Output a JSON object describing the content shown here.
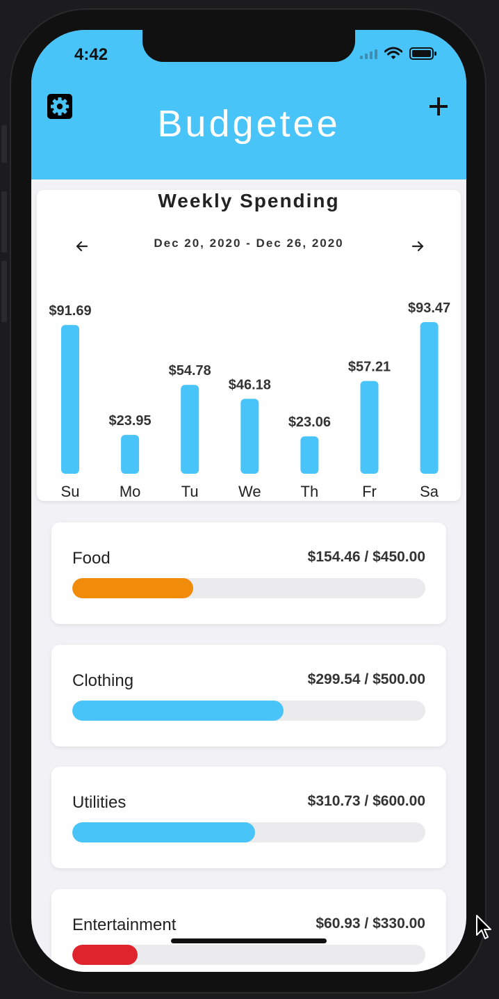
{
  "status_bar": {
    "time": "4:42"
  },
  "header": {
    "title": "Budgetee",
    "background_color": "#48c4f9",
    "settings_icon": "gear-icon",
    "add_icon": "plus-icon"
  },
  "weekly": {
    "title": "Weekly Spending",
    "date_range": "Dec 20, 2020 - Dec 26, 2020",
    "prev_icon": "arrow-left-icon",
    "next_icon": "arrow-right-icon"
  },
  "chart_data": {
    "type": "bar",
    "title": "Weekly Spending",
    "categories": [
      "Su",
      "Mo",
      "Tu",
      "We",
      "Th",
      "Fr",
      "Sa"
    ],
    "values": [
      91.69,
      23.95,
      54.78,
      46.18,
      23.06,
      57.21,
      93.47
    ],
    "value_labels": [
      "$91.69",
      "$23.95",
      "$54.78",
      "$46.18",
      "$23.06",
      "$57.21",
      "$93.47"
    ],
    "ylim": [
      0,
      93.47
    ],
    "grid": false,
    "bar_color": "#48c4f9"
  },
  "budgets": [
    {
      "name": "Food",
      "amount": "$154.46 / $450.00",
      "spent": 154.46,
      "limit": 450.0,
      "color": "#f18c0a"
    },
    {
      "name": "Clothing",
      "amount": "$299.54 / $500.00",
      "spent": 299.54,
      "limit": 500.0,
      "color": "#48c4f9"
    },
    {
      "name": "Utilities",
      "amount": "$310.73 / $600.00",
      "spent": 310.73,
      "limit": 600.0,
      "color": "#48c4f9"
    },
    {
      "name": "Entertainment",
      "amount": "$60.93 / $330.00",
      "spent": 60.93,
      "limit": 330.0,
      "color": "#e0242e"
    }
  ]
}
